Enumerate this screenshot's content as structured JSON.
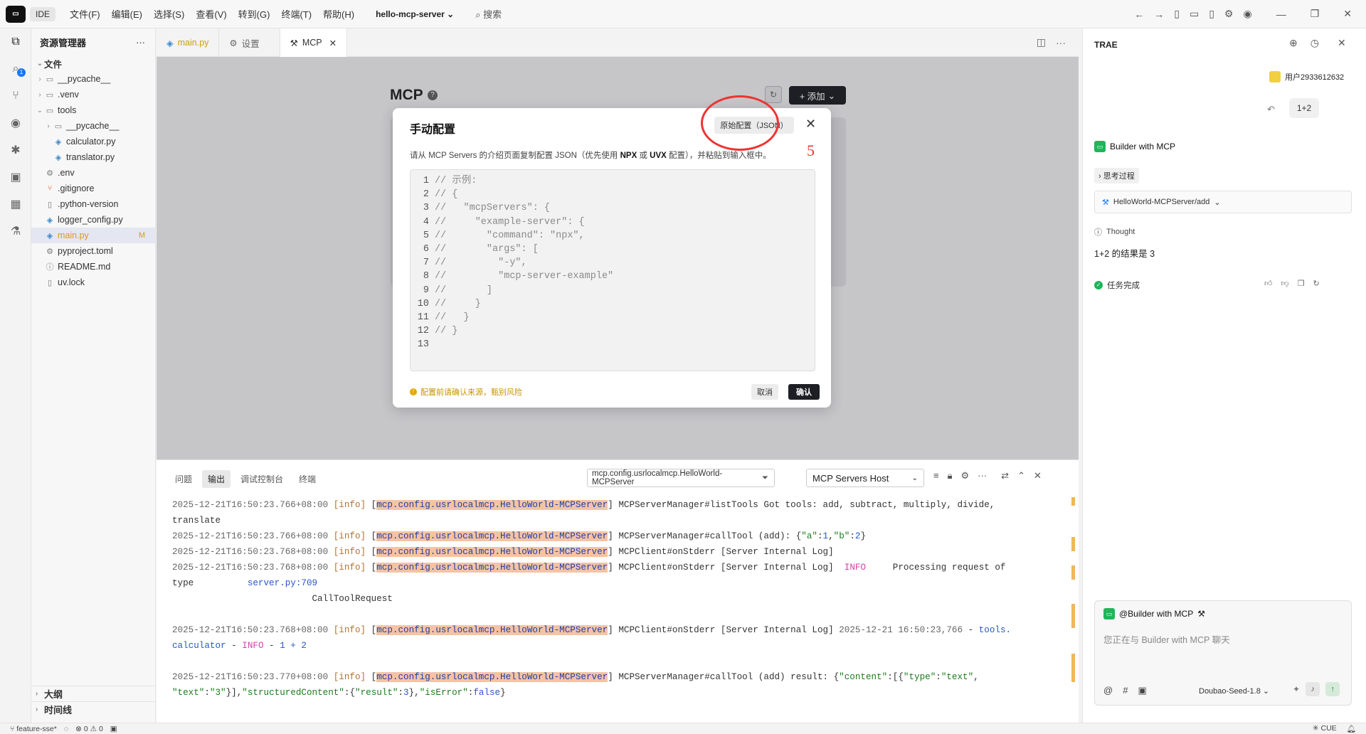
{
  "titlebar": {
    "ide_label": "IDE",
    "menu": [
      "文件(F)",
      "编辑(E)",
      "选择(S)",
      "查看(V)",
      "转到(G)",
      "终端(T)",
      "帮助(H)"
    ],
    "project": "hello-mcp-server",
    "search": "搜索"
  },
  "explorer": {
    "title": "资源管理器",
    "root": "文件",
    "items": [
      {
        "label": "__pycache__"
      },
      {
        "label": ".venv"
      },
      {
        "label": "tools"
      },
      {
        "label": "__pycache__"
      },
      {
        "label": "calculator.py"
      },
      {
        "label": "translator.py"
      },
      {
        "label": ".env"
      },
      {
        "label": ".gitignore"
      },
      {
        "label": ".python-version"
      },
      {
        "label": "logger_config.py"
      },
      {
        "label": "main.py",
        "badge": "M"
      },
      {
        "label": "pyproject.toml"
      },
      {
        "label": "README.md"
      },
      {
        "label": "uv.lock"
      }
    ],
    "outline": "大纲",
    "timeline": "时间线"
  },
  "tabs": [
    {
      "label": "main.py"
    },
    {
      "label": "设置"
    },
    {
      "label": "MCP"
    }
  ],
  "mcp_page": {
    "title": "MCP",
    "add_button": "+ 添加"
  },
  "modal": {
    "title": "手动配置",
    "raw_button": "原始配置（JSON）",
    "annotation": "5",
    "desc_pre": "请从 MCP Servers 的介绍页面复制配置 JSON（优先使用 ",
    "desc_b1": "NPX",
    "desc_mid": " 或 ",
    "desc_b2": "UVX",
    "desc_post": " 配置），并粘贴到输入框中。",
    "code_lines": [
      "// 示例:",
      "// {",
      "//   \"mcpServers\": {",
      "//     \"example-server\": {",
      "//       \"command\": \"npx\",",
      "//       \"args\": [",
      "//         \"-y\",",
      "//         \"mcp-server-example\"",
      "//       ]",
      "//     }",
      "//   }",
      "// }",
      ""
    ],
    "warning": "配置前请确认来源，甄别风险",
    "cancel": "取消",
    "confirm": "确认"
  },
  "panel": {
    "tabs": [
      "问题",
      "输出",
      "调试控制台",
      "终端"
    ],
    "filter_value": "mcp.config.usrlocalmcp.HelloWorld-MCPServer",
    "host_select": "MCP Servers Host",
    "log": {
      "ts1": "2025-12-21T16:50:23.766+08:00",
      "ts2": "2025-12-21T16:50:23.766+08:00",
      "ts3": "2025-12-21T16:50:23.768+08:00",
      "ts4": "2025-12-21T16:50:23.768+08:00",
      "ts5": "2025-12-21T16:50:23.768+08:00",
      "ts6": "2025-12-21T16:50:23.770+08:00",
      "level": "[info]",
      "source": "mcp.config.usrlocalmcp.HelloWorld-MCPServer",
      "l1_msg": "MCPServerManager#listTools Got tools: add, subtract, multiply, divide,",
      "l1_cont": "translate",
      "l2_msg": "MCPServerManager#callTool (add): {",
      "l3_msg": "MCPClient#onStderr [Server Internal Log]",
      "l4_msg": "MCPClient#onStderr [Server Internal Log]",
      "l4_info": "INFO",
      "l4_tail": "     Processing request of",
      "l4_type": "type",
      "l4_file": "server.py:709",
      "l4_req": "CallToolRequest",
      "l5_msg": "MCPClient#onStderr [Server Internal Log]",
      "l5_time": "2025-12-21 16:50:23,766",
      "l5_mod": "tools.",
      "l5_mod2": "calculator",
      "l5_info": "INFO",
      "l5_expr": "1 + 2",
      "l6_msg": "MCPServerManager#callTool (add) result: {"
    }
  },
  "chat": {
    "title": "TRAE",
    "user": "用户2933612632",
    "user_msg": "1+2",
    "agent": "Builder with MCP",
    "thinking": "思考过程",
    "tool": "HelloWorld-MCPServer/add",
    "thought": "Thought",
    "result": "1+2 的结果是 3",
    "done": "任务完成",
    "composer_agent": "@Builder with MCP",
    "placeholder": "您正在与 Builder with MCP 聊天",
    "model": "Doubao-Seed-1.8"
  },
  "status": {
    "branch": "feature-sse*",
    "errors": "0",
    "warnings": "0",
    "cue": "CUE"
  },
  "colors": {
    "accent": "#1fb55a",
    "annotation": "#e33333",
    "highlight": "#f5c3a3"
  }
}
